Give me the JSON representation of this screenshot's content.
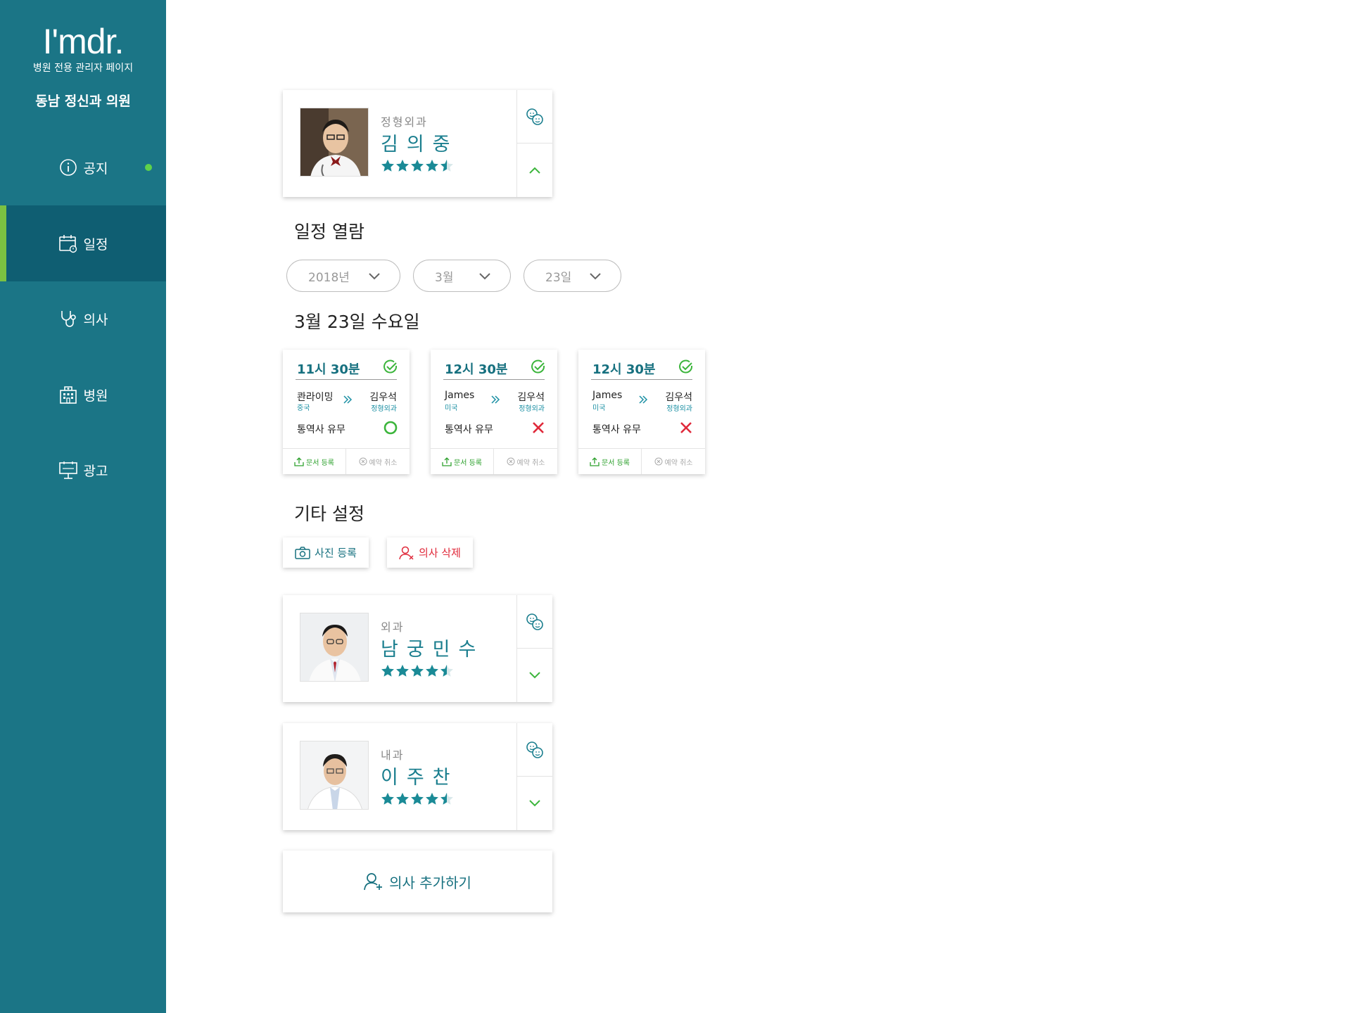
{
  "sidebar": {
    "logo": "I'mdr.",
    "subtitle": "병원 전용 관리자 페이지",
    "hospital_name": "동남 정신과 의원",
    "items": [
      {
        "label": "공지",
        "icon": "info-icon"
      },
      {
        "label": "일정",
        "icon": "calendar-icon"
      },
      {
        "label": "의사",
        "icon": "stethoscope-icon"
      },
      {
        "label": "병원",
        "icon": "hospital-icon"
      },
      {
        "label": "광고",
        "icon": "billboard-icon"
      }
    ],
    "active_item": "일정",
    "colors": {
      "background": "#1b7586",
      "active": "#0f5e72",
      "accent": "#7ac142"
    }
  },
  "doctors": [
    {
      "dept": "정형외과",
      "name": "김의중",
      "rating": 4.5,
      "expanded": true
    },
    {
      "dept": "외과",
      "name": "남궁민수",
      "rating": 4.5,
      "expanded": false
    },
    {
      "dept": "내과",
      "name": "이주찬",
      "rating": 4.5,
      "expanded": false
    }
  ],
  "schedule": {
    "title": "일정 열람",
    "year": "2018년",
    "month": "3월",
    "day": "23일",
    "date_heading": "3월 23일 수요일",
    "appointments": [
      {
        "time": "11시 30분",
        "patient": "콴라이밍",
        "patient_country": "중국",
        "doctor": "김우석",
        "doctor_dept": "정형외과",
        "interpreter_label": "통역사 유무",
        "interpreter": true,
        "doc_button": "문서 등록",
        "cancel_button": "예약 취소"
      },
      {
        "time": "12시 30분",
        "patient": "James",
        "patient_country": "미국",
        "doctor": "김우석",
        "doctor_dept": "정형외과",
        "interpreter_label": "통역사 유무",
        "interpreter": false,
        "doc_button": "문서 등록",
        "cancel_button": "예약 취소"
      },
      {
        "time": "12시 30분",
        "patient": "James",
        "patient_country": "미국",
        "doctor": "김우석",
        "doctor_dept": "정형외과",
        "interpreter_label": "통역사 유무",
        "interpreter": false,
        "doc_button": "문서 등록",
        "cancel_button": "예약 취소"
      }
    ]
  },
  "settings": {
    "title": "기타 설정",
    "photo_button": "사진 등록",
    "delete_button": "의사 삭제"
  },
  "add_doctor_button": "의사 추가하기"
}
